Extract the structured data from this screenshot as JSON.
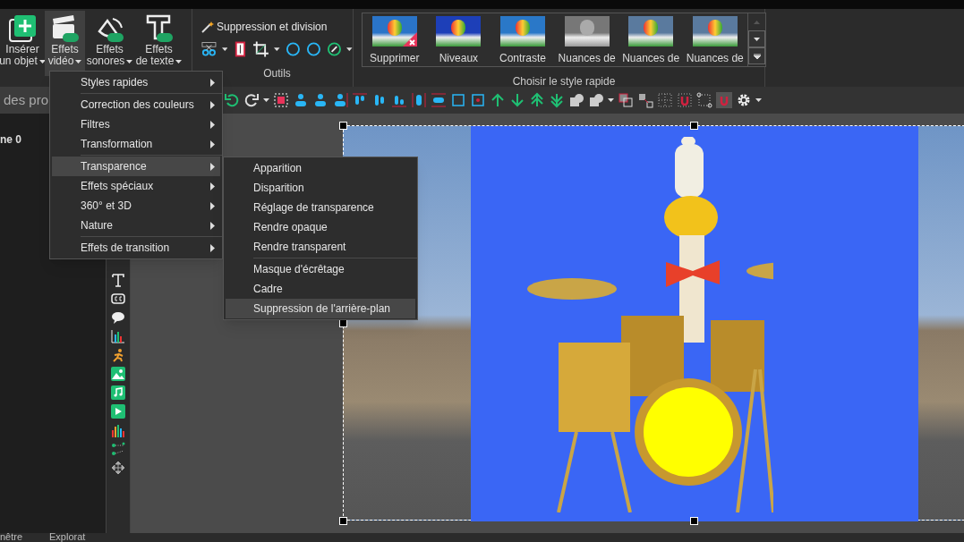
{
  "ribbon": {
    "buttons": [
      {
        "kind": "insert",
        "lines": [
          "Insérer",
          "un objet"
        ],
        "selected": false
      },
      {
        "kind": "video",
        "lines": [
          "Effets",
          "vidéo"
        ],
        "selected": true
      },
      {
        "kind": "audio",
        "lines": [
          "Effets",
          "sonores"
        ],
        "selected": false
      },
      {
        "kind": "text",
        "lines": [
          "Effets",
          "de texte"
        ],
        "selected": false
      }
    ],
    "tools": {
      "command": "Suppression et division",
      "label": "Outils"
    },
    "quick_styles": {
      "label": "Choisir le style rapide",
      "items": [
        {
          "label": "Supprimer",
          "kind": "remove"
        },
        {
          "label": "Niveaux",
          "kind": "vivid"
        },
        {
          "label": "Contraste",
          "kind": "normal"
        },
        {
          "label": "Nuances de",
          "kind": "gray"
        },
        {
          "label": "Nuances de",
          "kind": "muted"
        },
        {
          "label": "Nuances de",
          "kind": "muted"
        }
      ]
    }
  },
  "panel": {
    "tab": "des pro",
    "scene": "ne 0",
    "bottom_tabs": [
      "nêtre",
      "Explorat"
    ]
  },
  "menu": {
    "items": [
      {
        "label": "Styles rapides",
        "selected": false,
        "separator_before": false
      },
      {
        "label": "Correction des couleurs",
        "selected": false,
        "separator_before": true
      },
      {
        "label": "Filtres",
        "selected": false,
        "separator_before": false
      },
      {
        "label": "Transformation",
        "selected": false,
        "separator_before": false
      },
      {
        "label": "Transparence",
        "selected": true,
        "separator_before": true
      },
      {
        "label": "Effets spéciaux",
        "selected": false,
        "separator_before": false
      },
      {
        "label": "360° et 3D",
        "selected": false,
        "separator_before": false
      },
      {
        "label": "Nature",
        "selected": false,
        "separator_before": false
      },
      {
        "label": "Effets de transition",
        "selected": false,
        "separator_before": true
      }
    ],
    "submenu": [
      {
        "label": "Apparition",
        "selected": false,
        "separator_before": false
      },
      {
        "label": "Disparition",
        "selected": false,
        "separator_before": false
      },
      {
        "label": "Réglage de transparence",
        "selected": false,
        "separator_before": false
      },
      {
        "label": "Rendre opaque",
        "selected": false,
        "separator_before": false
      },
      {
        "label": "Rendre transparent",
        "selected": false,
        "separator_before": false
      },
      {
        "label": "Masque d'écrêtage",
        "selected": false,
        "separator_before": true
      },
      {
        "label": "Cadre",
        "selected": false,
        "separator_before": false
      },
      {
        "label": "Suppression de l'arrière-plan",
        "selected": true,
        "separator_before": false
      }
    ]
  }
}
